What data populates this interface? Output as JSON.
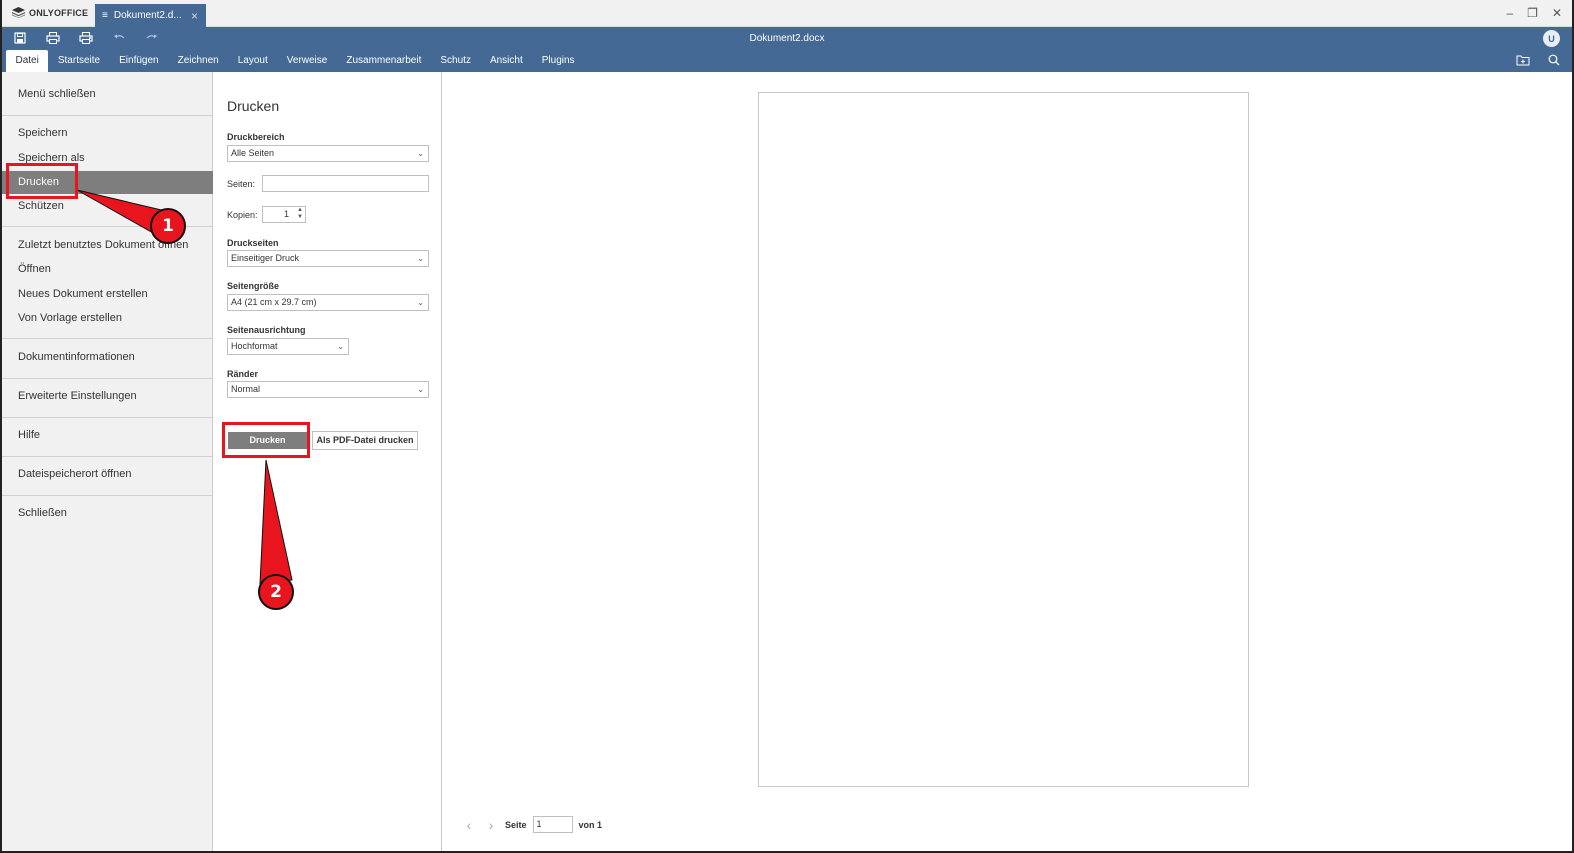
{
  "app": {
    "brand": "ONLYOFFICE",
    "tab_label": "Dokument2.d...",
    "doc_title": "Dokument2.docx",
    "avatar_initial": "U",
    "accent": "#446995"
  },
  "menu_tabs": [
    "Datei",
    "Startseite",
    "Einfügen",
    "Zeichnen",
    "Layout",
    "Verweise",
    "Zusammenarbeit",
    "Schutz",
    "Ansicht",
    "Plugins"
  ],
  "file_menu": {
    "close_menu": "Menü schließen",
    "save": "Speichern",
    "save_as": "Speichern als",
    "print": "Drucken",
    "protect": "Schützen",
    "recent": "Zuletzt benutztes Dokument öffnen",
    "open": "Öffnen",
    "new_doc": "Neues Dokument erstellen",
    "from_template": "Von Vorlage erstellen",
    "doc_info": "Dokumentinformationen",
    "advanced_settings": "Erweiterte Einstellungen",
    "help": "Hilfe",
    "open_location": "Dateispeicherort öffnen",
    "close": "Schließen"
  },
  "print_panel": {
    "title": "Drucken",
    "print_range_label": "Druckbereich",
    "print_range_value": "Alle Seiten",
    "pages_label": "Seiten:",
    "pages_value": "",
    "copies_label": "Kopien:",
    "copies_value": "1",
    "sides_label": "Druckseiten",
    "sides_value": "Einseitiger Druck",
    "page_size_label": "Seitengröße",
    "page_size_value": "A4 (21 cm x 29.7 cm)",
    "orientation_label": "Seitenausrichtung",
    "orientation_value": "Hochformat",
    "margins_label": "Ränder",
    "margins_value": "Normal",
    "print_button": "Drucken",
    "pdf_button": "Als PDF-Datei drucken"
  },
  "preview": {
    "page_label": "Seite",
    "page_value": "1",
    "of_label": "von 1"
  },
  "annotations": {
    "badge_1": "1",
    "badge_2": "2",
    "color": "#e8141e"
  }
}
